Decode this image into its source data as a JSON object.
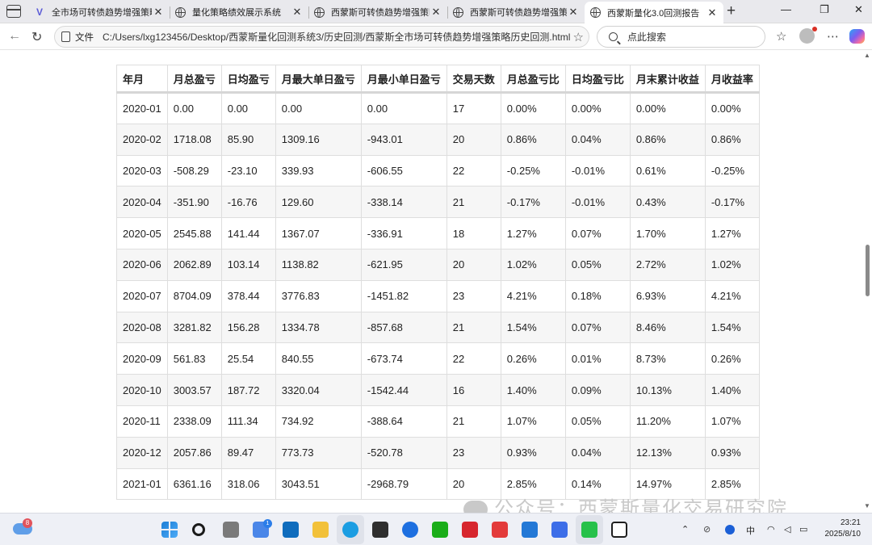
{
  "tabs": [
    {
      "label": "全市场可转债趋势增强策略",
      "icon": "v-logo-icon",
      "active": false
    },
    {
      "label": "量化策略绩效展示系统",
      "icon": "globe-icon",
      "active": false
    },
    {
      "label": "西蒙斯可转债趋势增强策略",
      "icon": "globe-icon",
      "active": false
    },
    {
      "label": "西蒙斯可转债趋势增强策略",
      "icon": "globe-icon",
      "active": false
    },
    {
      "label": "西蒙斯量化3.0回测报告",
      "icon": "globe-icon",
      "active": true
    }
  ],
  "address": {
    "file_label": "文件",
    "url": "C:/Users/lxg123456/Desktop/西蒙斯量化回测系统3/历史回测/西蒙斯全市场可转债趋势增强策略历史回测.html"
  },
  "search": {
    "placeholder": "点此搜索"
  },
  "table": {
    "headers": [
      "年月",
      "月总盈亏",
      "日均盈亏",
      "月最大单日盈亏",
      "月最小单日盈亏",
      "交易天数",
      "月总盈亏比",
      "日均盈亏比",
      "月末累计收益",
      "月收益率"
    ],
    "rows": [
      [
        "2020-01",
        "0.00",
        "0.00",
        "0.00",
        "0.00",
        "17",
        "0.00%",
        "0.00%",
        "0.00%",
        "0.00%"
      ],
      [
        "2020-02",
        "1718.08",
        "85.90",
        "1309.16",
        "-943.01",
        "20",
        "0.86%",
        "0.04%",
        "0.86%",
        "0.86%"
      ],
      [
        "2020-03",
        "-508.29",
        "-23.10",
        "339.93",
        "-606.55",
        "22",
        "-0.25%",
        "-0.01%",
        "0.61%",
        "-0.25%"
      ],
      [
        "2020-04",
        "-351.90",
        "-16.76",
        "129.60",
        "-338.14",
        "21",
        "-0.17%",
        "-0.01%",
        "0.43%",
        "-0.17%"
      ],
      [
        "2020-05",
        "2545.88",
        "141.44",
        "1367.07",
        "-336.91",
        "18",
        "1.27%",
        "0.07%",
        "1.70%",
        "1.27%"
      ],
      [
        "2020-06",
        "2062.89",
        "103.14",
        "1138.82",
        "-621.95",
        "20",
        "1.02%",
        "0.05%",
        "2.72%",
        "1.02%"
      ],
      [
        "2020-07",
        "8704.09",
        "378.44",
        "3776.83",
        "-1451.82",
        "23",
        "4.21%",
        "0.18%",
        "6.93%",
        "4.21%"
      ],
      [
        "2020-08",
        "3281.82",
        "156.28",
        "1334.78",
        "-857.68",
        "21",
        "1.54%",
        "0.07%",
        "8.46%",
        "1.54%"
      ],
      [
        "2020-09",
        "561.83",
        "25.54",
        "840.55",
        "-673.74",
        "22",
        "0.26%",
        "0.01%",
        "8.73%",
        "0.26%"
      ],
      [
        "2020-10",
        "3003.57",
        "187.72",
        "3320.04",
        "-1542.44",
        "16",
        "1.40%",
        "0.09%",
        "10.13%",
        "1.40%"
      ],
      [
        "2020-11",
        "2338.09",
        "111.34",
        "734.92",
        "-388.64",
        "21",
        "1.07%",
        "0.05%",
        "11.20%",
        "1.07%"
      ],
      [
        "2020-12",
        "2057.86",
        "89.47",
        "773.73",
        "-520.78",
        "23",
        "0.93%",
        "0.04%",
        "12.13%",
        "0.93%"
      ],
      [
        "2021-01",
        "6361.16",
        "318.06",
        "3043.51",
        "-2968.79",
        "20",
        "2.85%",
        "0.14%",
        "14.97%",
        "2.85%"
      ]
    ]
  },
  "watermark": "公众号：西蒙斯量化交易研究院",
  "taskbar": {
    "weather_badge": "8",
    "store_badge": "1",
    "tray_ime": "中",
    "clock_time": "23:21",
    "clock_date": "2025/8/10"
  }
}
